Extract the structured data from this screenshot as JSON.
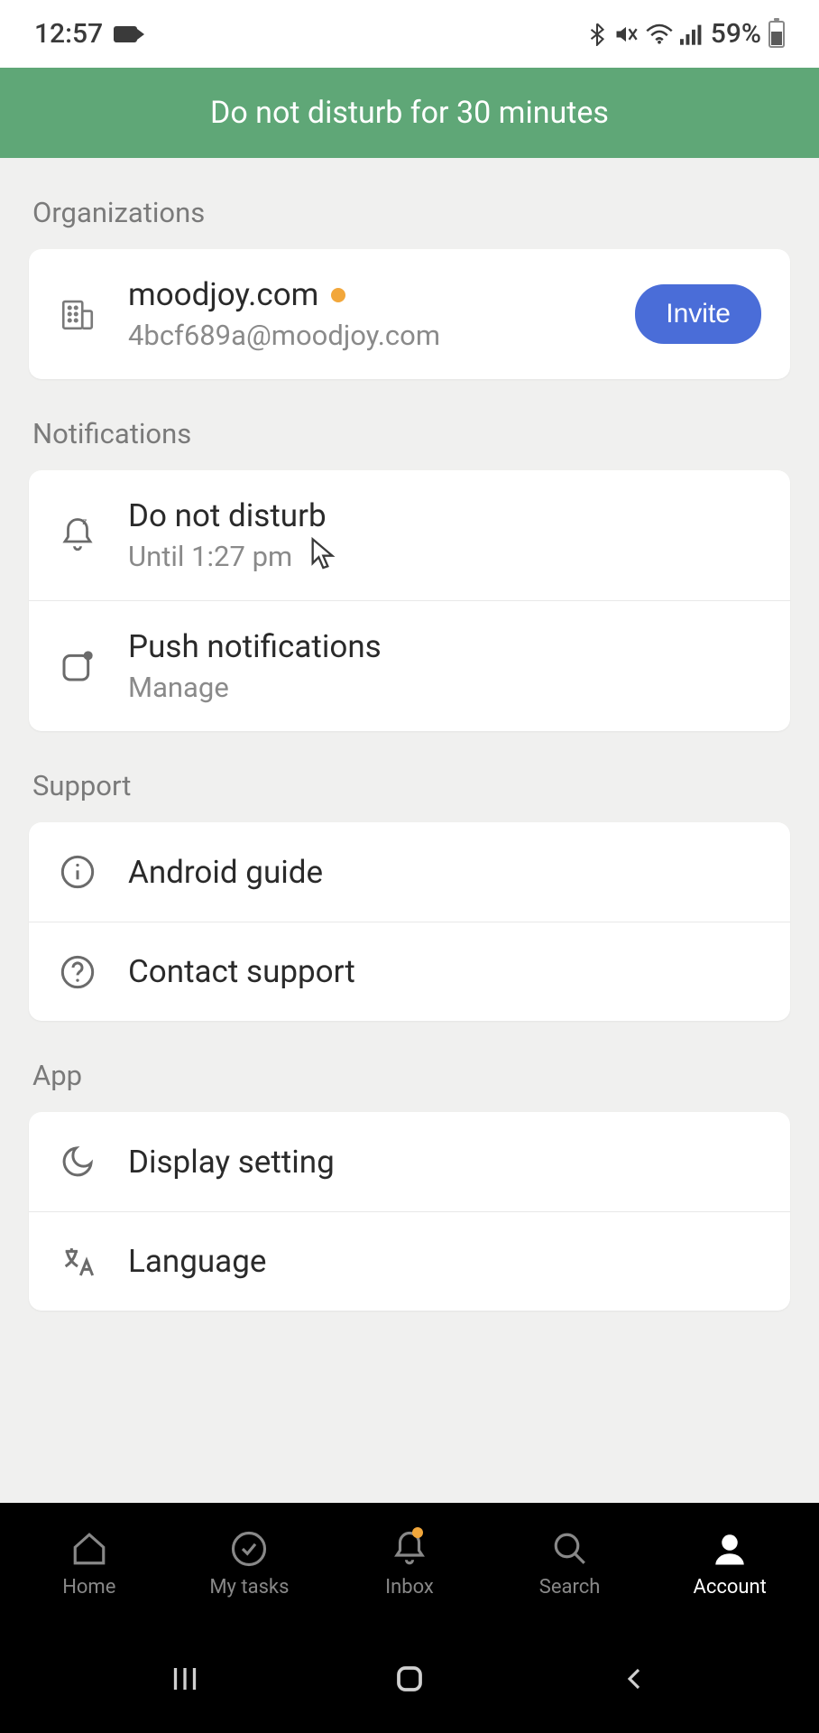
{
  "status_bar": {
    "time": "12:57",
    "battery": "59%"
  },
  "banner": {
    "text": "Do not disturb for 30 minutes"
  },
  "sections": {
    "organizations": {
      "header": "Organizations",
      "org_name": "moodjoy.com",
      "org_email": "4bcf689a@moodjoy.com",
      "invite_label": "Invite"
    },
    "notifications": {
      "header": "Notifications",
      "dnd_title": "Do not disturb",
      "dnd_subtitle": "Until 1:27 pm",
      "push_title": "Push notifications",
      "push_subtitle": "Manage"
    },
    "support": {
      "header": "Support",
      "guide_title": "Android guide",
      "contact_title": "Contact support"
    },
    "app": {
      "header": "App",
      "display_title": "Display setting",
      "language_title": "Language"
    }
  },
  "nav": {
    "home": "Home",
    "tasks": "My tasks",
    "inbox": "Inbox",
    "search": "Search",
    "account": "Account"
  }
}
